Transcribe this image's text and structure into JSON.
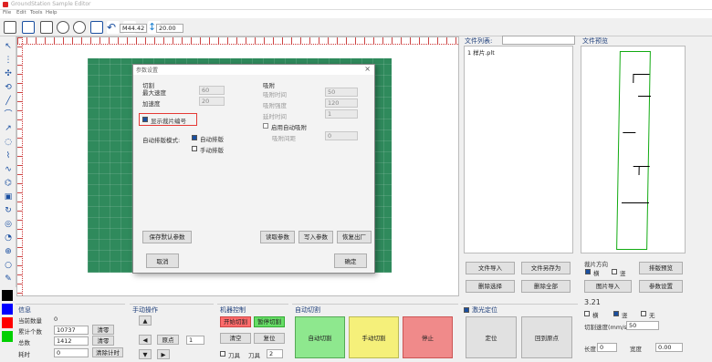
{
  "window": {
    "title": "GroundStation Sample Editor"
  },
  "menu": {
    "items": [
      "File",
      "Edit",
      "Tools",
      "Help"
    ]
  },
  "toolbar": {
    "field1": "M44.42",
    "field2": "20.00"
  },
  "left_tools": [
    "pointer-tool",
    "select-tool",
    "move-tool",
    "rotate-tool",
    "line-tool",
    "arc-tool",
    "rect-tool",
    "circle-tool",
    "ellipse-tool",
    "curve-tool",
    "spline-tool",
    "polyline-tool",
    "text-tool",
    "measure-tool",
    "node-tool",
    "split-tool",
    "zoom-tool",
    "paint-tool"
  ],
  "colors": {
    "black": "#000000",
    "blue": "#0000ff",
    "red": "#ff0000",
    "green": "#00d000",
    "accent": "#1f3f7a",
    "highlight": "#e53935",
    "board": "#2f8a5c"
  },
  "dialog": {
    "title": "参数设置",
    "left_group": "切割",
    "speed_label": "最大速度",
    "speed_value": "60",
    "accel_label": "加速度",
    "accel_value": "20",
    "highlight_checkbox": "显示裁片编号",
    "mode_label": "自动排版模式:",
    "mode_opt1": "自动排版",
    "mode_opt2": "手动排版",
    "right_group": "吸附",
    "r1_label": "吸附时间",
    "r1_value": "50",
    "r2_label": "吸附强度",
    "r2_value": "120",
    "r3_label": "延时时间",
    "r3_value": "1",
    "r_check": "启用自动吸附",
    "r4_label": "吸附间距",
    "r4_value": "0",
    "btn_save_default": "保存默认参数",
    "btn_r1": "读取参数",
    "btn_r2": "写入参数",
    "btn_r3": "恢复出厂",
    "btn_cancel": "取消",
    "btn_ok": "确定"
  },
  "file_panel": {
    "title": "文件列表:",
    "item": "1 样片.plt"
  },
  "preview_panel": {
    "title": "文件预览"
  },
  "right_buttons": {
    "b1": "文件导入",
    "b2": "文件另存为",
    "b3": "删除选择",
    "b4": "删除全部"
  },
  "preview_side": {
    "label": "裁片方向",
    "opt1": "横",
    "opt2": "竖",
    "b1": "排版预览",
    "b2": "图片导入",
    "b3": "参数设置"
  },
  "params": {
    "title": "3.21",
    "opt1": "横",
    "opt2": "竖",
    "opt3": "无",
    "label": "切割速度(mm/s)",
    "value": "50",
    "l2": "长度",
    "v2": "0",
    "l3": "宽度",
    "v3": "0.00"
  },
  "info": {
    "title": "信息",
    "l1": "当前数量",
    "v1": "0",
    "l2": "累计个数",
    "v2": "10737",
    "btn1": "清零",
    "l3": "总数",
    "v3": "1412",
    "btn2": "清零",
    "l4": "耗时",
    "v4": "0",
    "btn3": "清除计时"
  },
  "manual": {
    "title": "手动操作",
    "center": "原点",
    "field": "1"
  },
  "machine": {
    "title": "机器控制",
    "b1": "开始切割",
    "b2": "暂停切割",
    "b3": "清空",
    "b4": "复位",
    "check": "刀具",
    "field_label": "刀具",
    "field_value": "2"
  },
  "auto": {
    "title": "自动切割",
    "b1": "自动切割",
    "b2": "手动切割",
    "b3": "停止"
  },
  "laser": {
    "title": "激光定位",
    "b1": "定位",
    "b2": "回到原点"
  }
}
